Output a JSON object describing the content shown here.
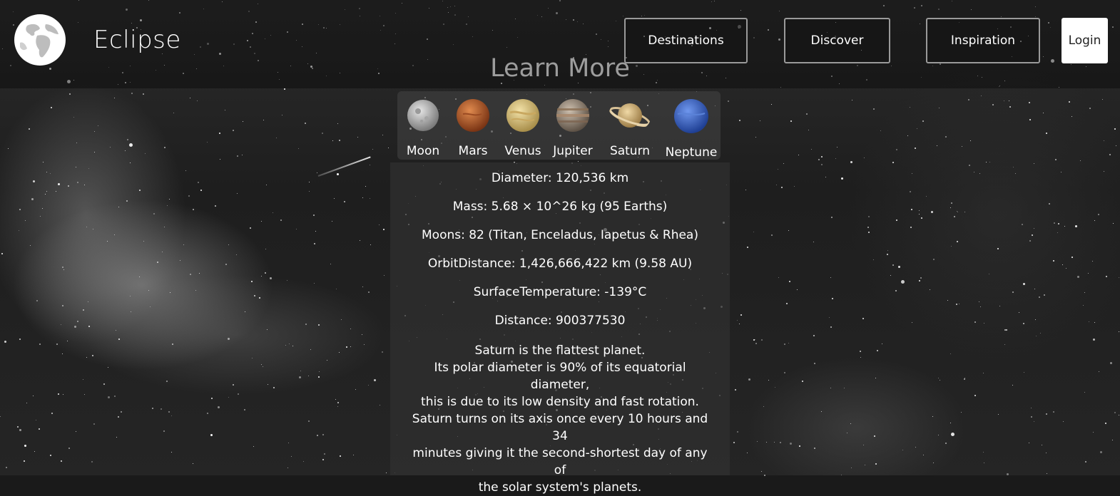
{
  "header": {
    "brand": "Eclipse",
    "nav": [
      "Destinations",
      "Discover",
      "Inspiration"
    ],
    "login": "Login"
  },
  "section_title": "Learn More",
  "planets": [
    {
      "name": "Moon",
      "color": "#bdbdbd"
    },
    {
      "name": "Mars",
      "color": "#c4622d"
    },
    {
      "name": "Venus",
      "color": "#d9c27a"
    },
    {
      "name": "Jupiter",
      "color": "#9c8c7a"
    },
    {
      "name": "Saturn",
      "color": "#d4b47a"
    },
    {
      "name": "Neptune",
      "color": "#3f6fd0"
    }
  ],
  "info": {
    "diameter": "Diameter: 120,536 km",
    "mass": "Mass: 5.68 × 10^26 kg (95 Earths)",
    "moons": "Moons: 82 (Titan, Enceladus, Iapetus & Rhea)",
    "orbit": "OrbitDistance: 1,426,666,422 km (9.58 AU)",
    "temperature": "SurfaceTemperature: -139°C",
    "distance": "Distance: 900377530",
    "description": [
      "Saturn is the flattest planet.",
      "Its polar diameter is 90% of its equatorial diameter,",
      "this is due to its low density and fast rotation.",
      "Saturn turns on its axis once every 10 hours and 34",
      "minutes giving it the second-shortest day of any of",
      "the solar system's planets."
    ]
  }
}
